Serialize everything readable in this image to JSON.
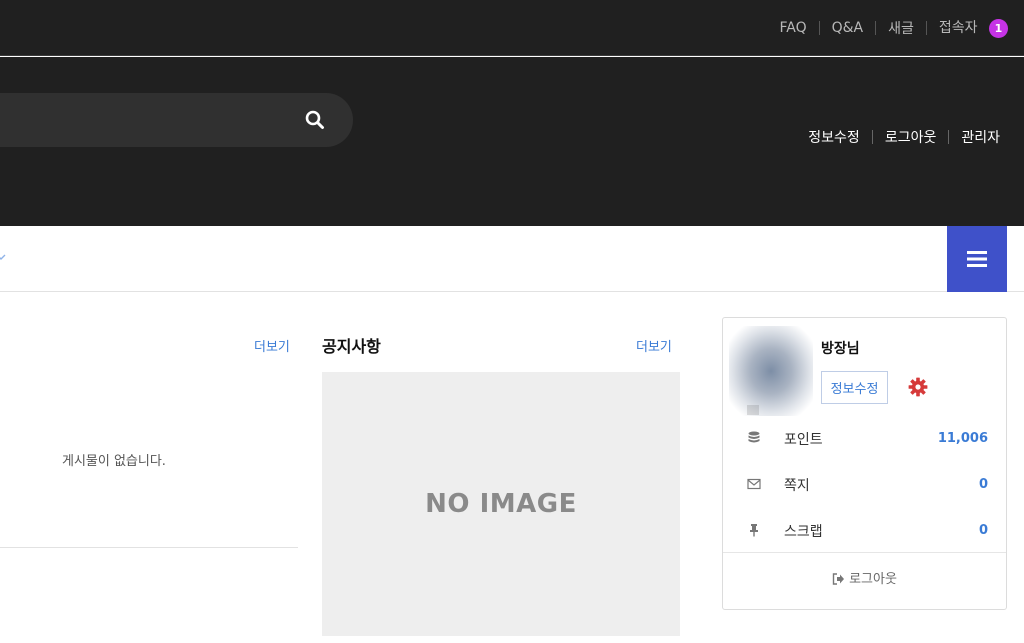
{
  "topbar": {
    "links": [
      "FAQ",
      "Q&A",
      "새글",
      "접속자"
    ],
    "visitor_count": "1",
    "badge_color": "#c633e6"
  },
  "header": {
    "search_icon": "search-icon",
    "member_links": [
      "정보수정",
      "로그아웃",
      "관리자"
    ]
  },
  "nav": {
    "menu_icon": "hamburger-icon",
    "accent_color": "#3f51c9"
  },
  "board_left": {
    "more_label": "더보기",
    "empty_message": "게시물이 없습니다."
  },
  "notice": {
    "title": "공지사항",
    "more_label": "더보기",
    "placeholder_text": "NO IMAGE"
  },
  "profile": {
    "nickname": "방장님",
    "edit_label": "정보수정",
    "settings_icon": "gear-icon",
    "items": [
      {
        "icon": "database-icon",
        "label": "포인트",
        "value": "11,006"
      },
      {
        "icon": "envelope-icon",
        "label": "쪽지",
        "value": "0"
      },
      {
        "icon": "pin-icon",
        "label": "스크랩",
        "value": "0"
      }
    ],
    "logout_label": "로그아웃"
  }
}
